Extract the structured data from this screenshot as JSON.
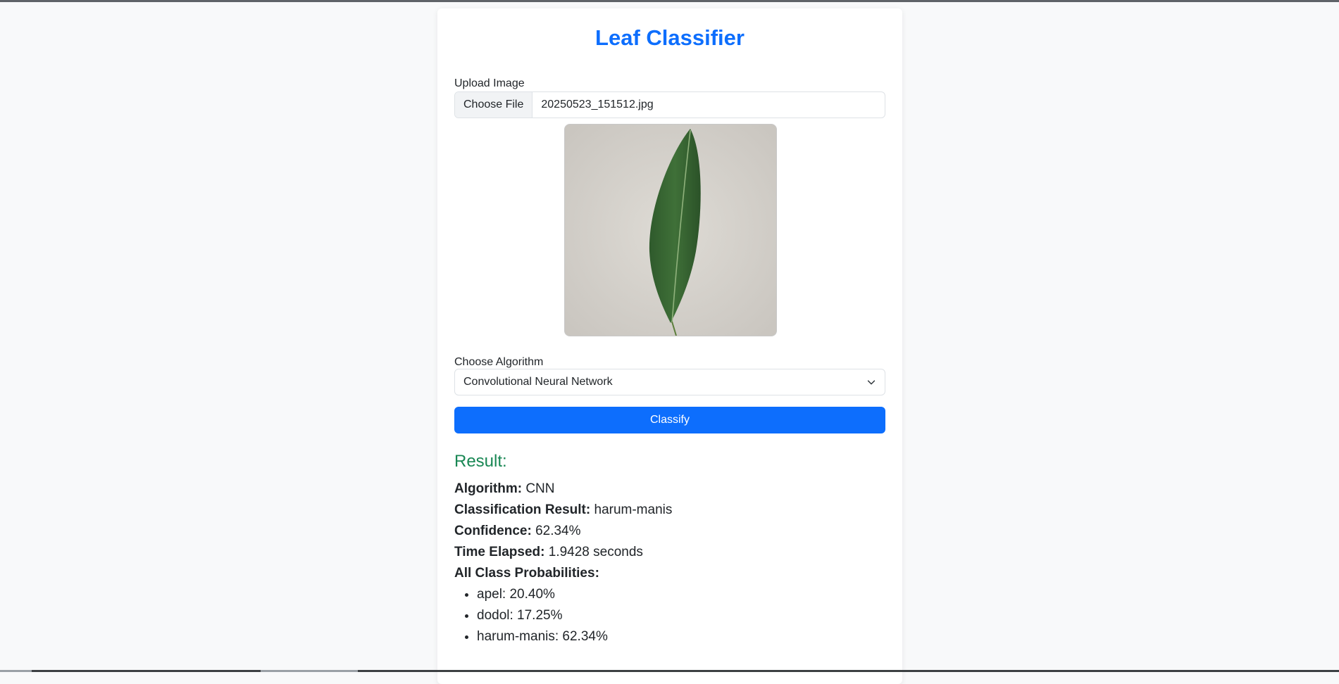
{
  "app": {
    "title": "Leaf Classifier"
  },
  "upload": {
    "label": "Upload Image",
    "button_label": "Choose File",
    "file_name": "20250523_151512.jpg"
  },
  "algorithm": {
    "label": "Choose Algorithm",
    "selected": "Convolutional Neural Network"
  },
  "classify_button": "Classify",
  "result": {
    "heading": "Result:",
    "algorithm_label": "Algorithm:",
    "algorithm_value": "CNN",
    "classification_label": "Classification Result:",
    "classification_value": "harum-manis",
    "confidence_label": "Confidence:",
    "confidence_value": "62.34%",
    "time_label": "Time Elapsed:",
    "time_value": "1.9428 seconds",
    "probabilities_label": "All Class Probabilities:",
    "probabilities": [
      "apel: 20.40%",
      "dodol: 17.25%",
      "harum-manis: 62.34%"
    ]
  },
  "colors": {
    "primary": "#0d6efd",
    "success": "#198754",
    "background": "#f8f9fa"
  },
  "icons": {
    "select_chevron": "chevron-down-icon"
  }
}
